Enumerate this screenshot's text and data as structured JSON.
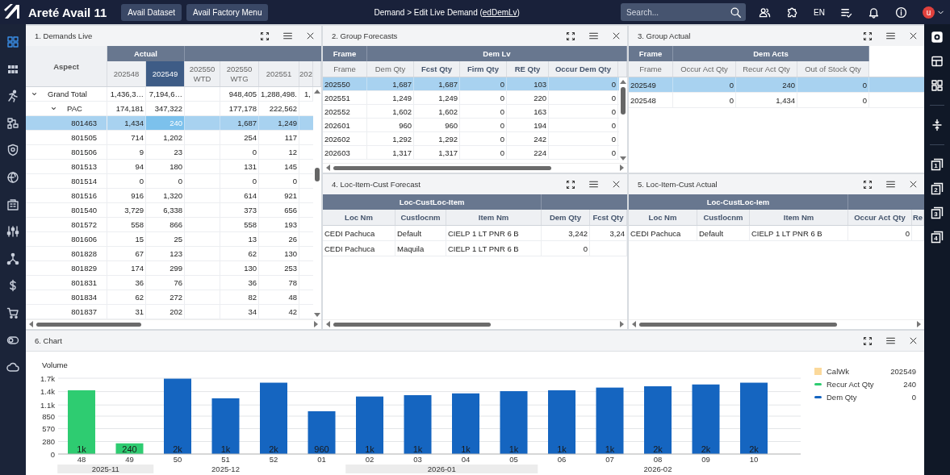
{
  "topbar": {
    "app_name": "Areté Avail 11",
    "buttons": [
      "Avail Dataset",
      "Avail Factory Menu"
    ],
    "breadcrumb": {
      "before": "Demand > Edit Live Demand (",
      "link": "edDemLv",
      "after": ")"
    },
    "search": {
      "placeholder": "Search..."
    },
    "language": "EN",
    "avatar": "u"
  },
  "left_nav": [
    {
      "kind": "dashboard",
      "selected": true
    },
    {
      "kind": "apps",
      "selected": false
    },
    {
      "kind": "runner",
      "selected": false
    },
    {
      "kind": "hierarchy",
      "selected": false
    },
    {
      "kind": "shield",
      "selected": false
    },
    {
      "kind": "globe",
      "selected": false
    },
    {
      "kind": "building",
      "selected": false
    },
    {
      "kind": "sliders",
      "selected": false
    },
    {
      "kind": "network",
      "selected": false
    },
    {
      "kind": "dollar",
      "selected": false
    },
    {
      "kind": "cart",
      "selected": false
    },
    {
      "kind": "toggle",
      "selected": false
    },
    {
      "kind": "cloud",
      "selected": false
    }
  ],
  "panels": [
    {
      "title": "1. Demands Live",
      "row_header": "Aspect",
      "groups": [
        {
          "label": "Actual",
          "columns": [
            {
              "label": "202548",
              "kind": "number",
              "selected": false
            },
            {
              "label": "202549",
              "kind": "number",
              "selected": true
            }
          ]
        },
        {
          "columns": [
            {
              "label": "202550\nWTD",
              "kind": "number",
              "selected": false
            },
            {
              "label": "202550\nWTG",
              "kind": "number",
              "selected": false
            },
            {
              "label": "202551",
              "kind": "number",
              "selected": false
            },
            {
              "label": "202",
              "kind": "number",
              "selected": false
            }
          ]
        }
      ],
      "rows": [
        {
          "label": "Grand Total",
          "expanded": true,
          "selected": false,
          "cells": [
            "1,436,3…",
            "7,194,6…",
            null,
            "948,405",
            "1,288,498.",
            "1,"
          ],
          "children": [
            {
              "label": "PAC",
              "expanded": true,
              "selected": false,
              "cells": [
                "174,181",
                "347,322",
                null,
                "177,178",
                "222,562"
              ],
              "children": [
                {
                  "label": "801463",
                  "selected": true,
                  "cells": [
                    "1,434",
                    "240",
                    null,
                    "1,687",
                    "1,249"
                  ]
                },
                {
                  "label": "801505",
                  "selected": false,
                  "cells": [
                    "714",
                    "1,202",
                    null,
                    "254",
                    "117"
                  ]
                },
                {
                  "label": "801506",
                  "selected": false,
                  "cells": [
                    "9",
                    "23",
                    null,
                    "0",
                    "12"
                  ]
                },
                {
                  "label": "801513",
                  "selected": false,
                  "cells": [
                    "94",
                    "180",
                    null,
                    "131",
                    "145"
                  ]
                },
                {
                  "label": "801514",
                  "selected": false,
                  "cells": [
                    "0",
                    "0",
                    null,
                    "0",
                    "0"
                  ]
                },
                {
                  "label": "801516",
                  "selected": false,
                  "cells": [
                    "916",
                    "1,320",
                    null,
                    "614",
                    "921"
                  ]
                },
                {
                  "label": "801540",
                  "selected": false,
                  "cells": [
                    "3,729",
                    "6,338",
                    null,
                    "373",
                    "656"
                  ]
                },
                {
                  "label": "801572",
                  "selected": false,
                  "cells": [
                    "558",
                    "866",
                    null,
                    "558",
                    "193"
                  ]
                },
                {
                  "label": "801606",
                  "selected": false,
                  "cells": [
                    "15",
                    "25",
                    null,
                    "13",
                    "26"
                  ]
                },
                {
                  "label": "801828",
                  "selected": false,
                  "cells": [
                    "67",
                    "123",
                    null,
                    "62",
                    "130"
                  ]
                },
                {
                  "label": "801829",
                  "selected": false,
                  "cells": [
                    "174",
                    "299",
                    null,
                    "130",
                    "253"
                  ]
                },
                {
                  "label": "801831",
                  "selected": false,
                  "cells": [
                    "36",
                    "76",
                    null,
                    "36",
                    "78"
                  ]
                },
                {
                  "label": "801834",
                  "selected": false,
                  "cells": [
                    "62",
                    "272",
                    null,
                    "82",
                    "48"
                  ]
                },
                {
                  "label": "801837",
                  "selected": false,
                  "cells": [
                    "31",
                    "202",
                    null,
                    "34",
                    "42"
                  ]
                }
              ]
            }
          ]
        }
      ]
    },
    {
      "title": "2. Group Forecasts",
      "groups": [
        {
          "label": "Frame",
          "columns": [
            {
              "label": "Frame",
              "kind": "text",
              "editable": false
            }
          ]
        },
        {
          "label": "Dem Lv",
          "columns": [
            {
              "label": "Dem Qty",
              "kind": "number",
              "editable": false
            },
            {
              "label": "Fcst Qty",
              "kind": "number",
              "editable": true
            },
            {
              "label": "Firm Qty",
              "kind": "number",
              "editable": true
            },
            {
              "label": "RE Qty",
              "kind": "number",
              "editable": true
            },
            {
              "label": "Occur Dem Qty",
              "kind": "number",
              "editable": true
            }
          ]
        }
      ],
      "rows": [
        {
          "selected": true,
          "cells": [
            "202550",
            "1,687",
            "1,687",
            "0",
            "103",
            "0"
          ]
        },
        {
          "selected": false,
          "cells": [
            "202551",
            "1,249",
            "1,249",
            "0",
            "220",
            "0"
          ]
        },
        {
          "selected": false,
          "cells": [
            "202552",
            "1,602",
            "1,602",
            "0",
            "163",
            "0"
          ]
        },
        {
          "selected": false,
          "cells": [
            "202601",
            "960",
            "960",
            "0",
            "194",
            "0"
          ]
        },
        {
          "selected": false,
          "cells": [
            "202602",
            "1,292",
            "1,292",
            "0",
            "242",
            "0"
          ]
        },
        {
          "selected": false,
          "cells": [
            "202603",
            "1,317",
            "1,317",
            "0",
            "224",
            "0"
          ]
        }
      ]
    },
    {
      "title": "3. Group Actual",
      "groups": [
        {
          "label": "Frame",
          "columns": [
            {
              "label": "Frame",
              "kind": "text",
              "editable": false
            }
          ]
        },
        {
          "label": "Dem Acts",
          "columns": [
            {
              "label": "Occur Act Qty",
              "kind": "number",
              "editable": false
            },
            {
              "label": "Recur Act Qty",
              "kind": "number",
              "editable": false
            },
            {
              "label": "Out of Stock Qty",
              "kind": "number",
              "editable": false
            }
          ]
        }
      ],
      "rows": [
        {
          "selected": true,
          "cells": [
            "202549",
            "0",
            "240",
            "0"
          ]
        },
        {
          "selected": false,
          "cells": [
            "202548",
            "0",
            "1,434",
            "0"
          ]
        }
      ]
    },
    {
      "title": "4. Loc-Item-Cust Forecast",
      "groups": [
        {
          "label": "Loc-CustLoc-Item",
          "columns": [
            {
              "label": "Loc Nm",
              "kind": "text",
              "editable": true
            },
            {
              "label": "Custlocnm",
              "kind": "text",
              "editable": true
            },
            {
              "label": "Item Nm",
              "kind": "text",
              "editable": true
            }
          ]
        },
        {
          "columns": [
            {
              "label": "Dem Qty",
              "kind": "number",
              "editable": true
            },
            {
              "label": "Fcst Qty",
              "kind": "number",
              "editable": true
            }
          ]
        }
      ],
      "rows": [
        {
          "selected": false,
          "cells": [
            "CEDI Pachuca",
            "Default",
            "CIELP 1 LT PNR 6 B",
            "3,242",
            "3,24"
          ]
        },
        {
          "selected": false,
          "cells": [
            "CEDI Pachuca",
            "Maquila",
            "CIELP 1 LT PNR 6 B",
            "0",
            null
          ]
        }
      ]
    },
    {
      "title": "5. Loc-Item-Cust Actual",
      "groups": [
        {
          "label": "Loc-CustLoc-Iem",
          "columns": [
            {
              "label": "Loc Nm",
              "kind": "text",
              "editable": true
            },
            {
              "label": "Custlocnm",
              "kind": "text",
              "editable": true
            },
            {
              "label": "Item Nm",
              "kind": "text",
              "editable": true
            }
          ]
        },
        {
          "columns": [
            {
              "label": "Occur Act Qty",
              "kind": "number",
              "editable": true
            },
            {
              "label": "Re",
              "kind": "number",
              "editable": true
            }
          ]
        }
      ],
      "rows": [
        {
          "selected": false,
          "cells": [
            "CEDI Pachuca",
            "Default",
            "CIELP 1 LT PNR 6 B",
            "0",
            null
          ]
        }
      ]
    }
  ],
  "chart_panel": {
    "title": "6. Chart",
    "chart_data": {
      "type": "bar",
      "ylabel": "Volume",
      "categories": [
        "48",
        "49",
        "50",
        "51",
        "52",
        "01",
        "02",
        "03",
        "04",
        "05",
        "06",
        "07",
        "08",
        "09",
        "10"
      ],
      "series": [
        {
          "name": "Recur Act Qty",
          "color": "#2ecc71",
          "values": [
            1430,
            240,
            null,
            null,
            null,
            null,
            null,
            null,
            null,
            null,
            null,
            null,
            null,
            null,
            null
          ]
        },
        {
          "name": "Dem Qty",
          "color": "#1565c0",
          "values": [
            null,
            null,
            1690,
            1250,
            1600,
            960,
            1290,
            1320,
            1360,
            1410,
            1430,
            1490,
            1520,
            1560,
            1600
          ]
        }
      ],
      "grid": true,
      "ylim": [
        0,
        1700
      ],
      "yticks": [
        0,
        280,
        570,
        850,
        {
          "value": 1100,
          "label": "1.1k"
        },
        {
          "value": 1400,
          "label": "1.4k"
        },
        {
          "value": 1700,
          "label": "1.7k"
        }
      ],
      "value_labels": [
        "1k",
        "240",
        "2k",
        "1k",
        "2k",
        "960",
        "1k",
        "1k",
        "1k",
        "1k",
        "1k",
        "1k",
        "2k",
        "2k",
        "2k"
      ]
    },
    "month_axis": [
      {
        "label": "2025-11",
        "shaded": true
      },
      {
        "label": "2025-12",
        "shaded": false
      },
      {
        "label": "2026-01",
        "shaded": true
      },
      {
        "label": "2026-02",
        "shaded": false
      }
    ],
    "legend": [
      {
        "kind": "square",
        "label": "CalWk",
        "value": "202549",
        "color": "#fbd99b"
      },
      {
        "kind": "series",
        "value": "240"
      },
      {
        "kind": "series",
        "value": "0"
      }
    ]
  },
  "right_nav": [
    [
      {
        "kind": "settings"
      },
      {
        "kind": "layout"
      },
      {
        "kind": "widgets"
      }
    ],
    [
      {
        "kind": "collapse"
      }
    ],
    [
      {
        "kind": "layer",
        "label": "1"
      },
      {
        "kind": "layer",
        "label": "2"
      },
      {
        "kind": "layer",
        "label": "3"
      },
      {
        "kind": "layer",
        "label": "4"
      }
    ]
  ]
}
